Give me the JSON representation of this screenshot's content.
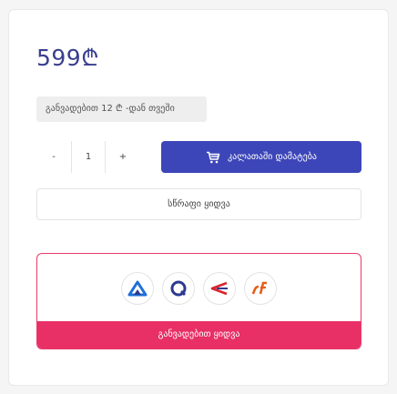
{
  "product": {
    "price": "599₾",
    "installment_text": "განვადებით 12 ₾ -დან თვეში"
  },
  "quantity": {
    "minus": "-",
    "value": "1",
    "plus": "+"
  },
  "actions": {
    "add_to_cart": "კალათაში დამატება",
    "quick_buy": "სწრაფი ყიდვა"
  },
  "installment_partners": [
    {
      "icon": "partner-a-logo-icon",
      "color": "#1e6fd9"
    },
    {
      "icon": "partner-b-logo-icon",
      "color": "#2c3b8f"
    },
    {
      "icon": "partner-c-logo-icon",
      "color": "#d9232d"
    },
    {
      "icon": "partner-d-logo-icon",
      "color": "#e85d1a"
    }
  ],
  "installment_button": "განვადებით ყიდვა",
  "colors": {
    "price": "#3a3f8f",
    "primary_button": "#3d46b8",
    "installment_accent": "#e82f66"
  }
}
